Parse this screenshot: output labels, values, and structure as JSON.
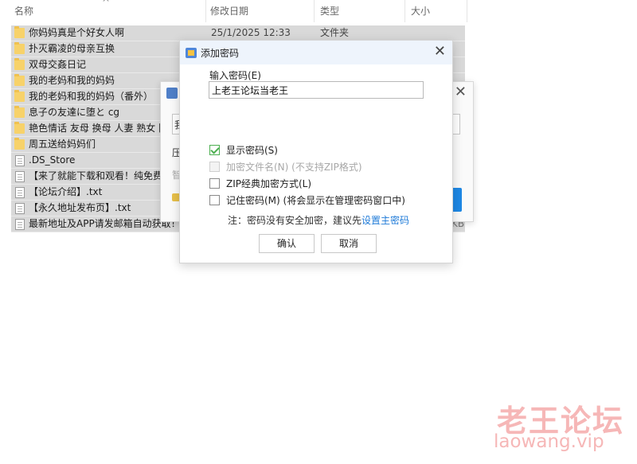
{
  "header": {
    "col_name": "名称",
    "col_date": "修改日期",
    "col_type": "类型",
    "col_size": "大小",
    "sort_indicator": "^"
  },
  "rows": [
    {
      "name": "你妈妈真是个好女人啊",
      "date": "25/1/2025 12:33",
      "type": "文件夹",
      "icon": "folder-icon"
    },
    {
      "name": "扑灭霸凌的母亲互换",
      "date": "",
      "type": "",
      "icon": "folder-icon"
    },
    {
      "name": "双母交姦日记",
      "date": "",
      "type": "",
      "icon": "folder-icon"
    },
    {
      "name": "我的老妈和我的妈妈",
      "date": "",
      "type": "",
      "icon": "folder-icon"
    },
    {
      "name": "我的老妈和我的妈妈（番外）",
      "date": "",
      "type": "",
      "icon": "folder-icon"
    },
    {
      "name": "息子の友達に堕と cg",
      "date": "",
      "type": "",
      "icon": "folder-icon"
    },
    {
      "name": "艳色情话 友母 换母 人妻 熟女 阿",
      "date": "",
      "type": "",
      "icon": "folder-icon"
    },
    {
      "name": "周五送给妈妈们",
      "date": "",
      "type": "",
      "icon": "folder-icon"
    },
    {
      "name": ".DS_Store",
      "date": "",
      "type": "",
      "icon": "file-icon"
    },
    {
      "name": "【来了就能下载和观看！纯免费！",
      "date": "",
      "type": "",
      "icon": "file-icon"
    },
    {
      "name": "【论坛介绍】.txt",
      "date": "",
      "type": "",
      "icon": "file-icon"
    },
    {
      "name": "【永久地址发布页】.txt",
      "date": "",
      "type": "",
      "icon": "file-icon"
    },
    {
      "name": "最新地址及APP请发邮箱自动获取！！",
      "date": "",
      "type": "",
      "icon": "file-icon"
    }
  ],
  "size_fragment": "KB",
  "back_dialog": {
    "input_fragment": "我",
    "label_fragment": "压",
    "label2_fragment": "智"
  },
  "dialog": {
    "title": "添加密码",
    "close": "✕",
    "password_label": "输入密码(E)",
    "password_value": "上老王论坛当老王",
    "options": {
      "show_password": "显示密码(S)",
      "encrypt_filenames": "加密文件名(N) (不支持ZIP格式)",
      "zip_classic": "ZIP经典加密方式(L)",
      "remember_password": "记住密码(M) (将会显示在管理密码窗口中)"
    },
    "note_prefix": "注：密码没有安全加密，建议先",
    "note_link": "设置主密码",
    "ok": "确认",
    "cancel": "取消"
  },
  "watermark": {
    "cn": "老王论坛",
    "en": "laowang.vip"
  }
}
